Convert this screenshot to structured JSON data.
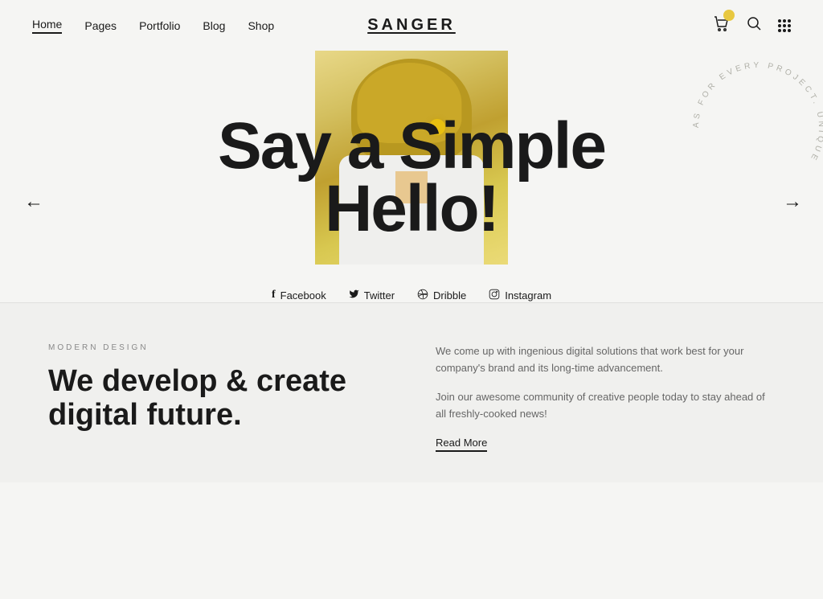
{
  "header": {
    "nav": {
      "home": "Home",
      "pages": "Pages",
      "portfolio": "Portfolio",
      "blog": "Blog",
      "shop": "Shop"
    },
    "logo": "SANGER",
    "icons": {
      "cart": "cart-icon",
      "search": "search-icon",
      "grid": "grid-icon"
    }
  },
  "hero": {
    "title_line1": "Say a Simple",
    "title_line2": "Hello!",
    "arrow_left": "←",
    "arrow_right": "→"
  },
  "social": {
    "links": [
      {
        "label": "Facebook",
        "icon": "f"
      },
      {
        "label": "Twitter",
        "icon": "🐦"
      },
      {
        "label": "Dribble",
        "icon": "⊕"
      },
      {
        "label": "Instagram",
        "icon": "◎"
      }
    ]
  },
  "rotating_text": "AS FOR EVERY PROJECT. UNIQUE",
  "bottom": {
    "section_label": "MODERN DESIGN",
    "section_title": "We develop & create digital future.",
    "body_p1": "We come up with ingenious digital solutions that work best for your company's brand and its long-time advancement.",
    "body_p2": "Join our awesome community of creative people today to stay ahead of all freshly-cooked news!",
    "read_more": "Read More"
  }
}
